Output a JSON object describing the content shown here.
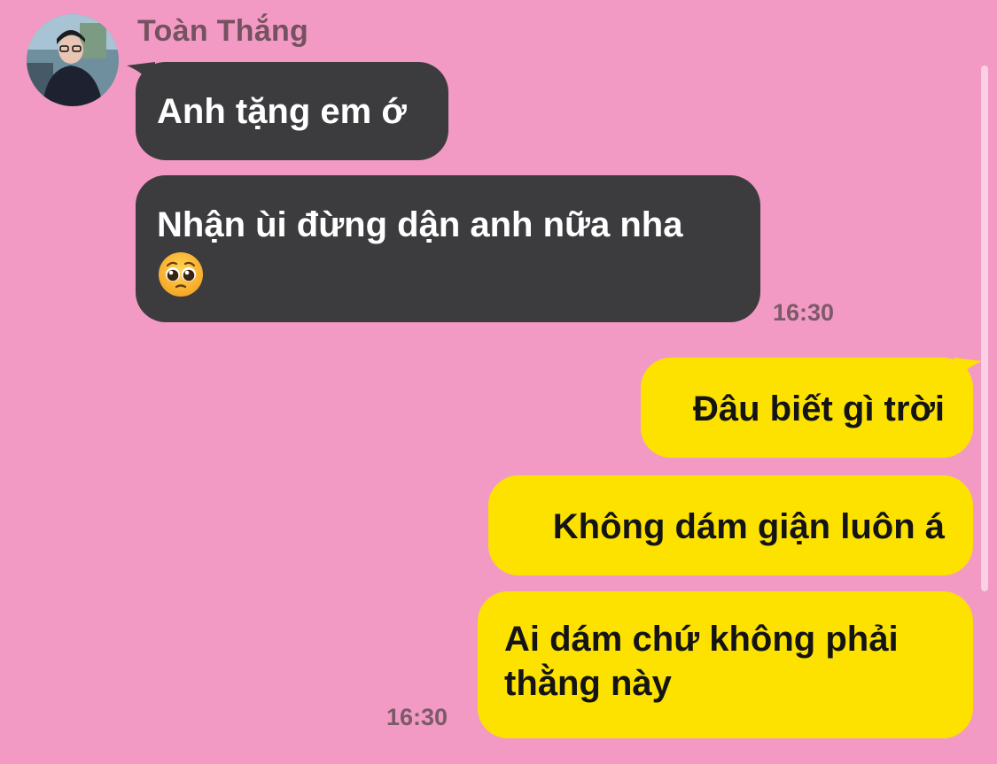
{
  "conversation": {
    "contact_name": "Toàn Thắng",
    "avatar_icon": "profile-photo-avatar",
    "incoming": [
      {
        "text": "Anh tặng em ớ"
      },
      {
        "text": "Nhận ùi đừng dận anh nữa nha",
        "emoji": "pleading-face-emoji"
      }
    ],
    "incoming_time": "16:30",
    "outgoing": [
      {
        "text": "Đâu biết gì trời"
      },
      {
        "text": "Không dám giận luôn á"
      },
      {
        "text": "Ai dám chứ không phải thằng này"
      }
    ],
    "outgoing_time": "16:30"
  },
  "colors": {
    "background": "#f39ac4",
    "incoming_bubble": "#3c3c3e",
    "outgoing_bubble": "#fde200",
    "name_text": "#745260",
    "time_text": "#7b5a69"
  }
}
